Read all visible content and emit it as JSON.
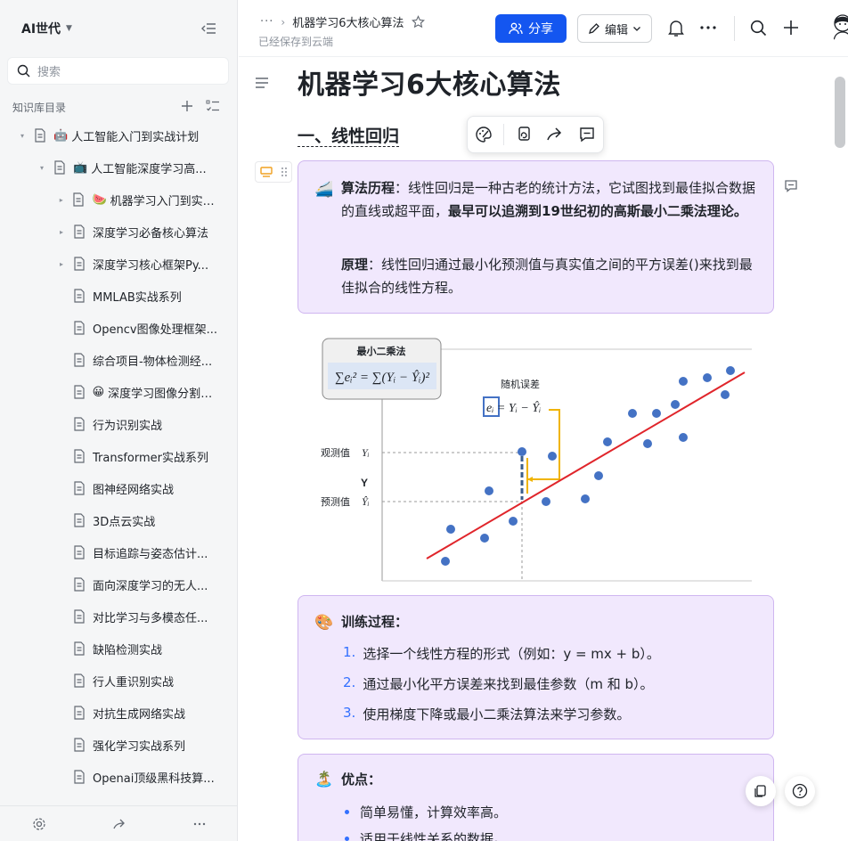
{
  "sidebar": {
    "workspace": "AI世代",
    "search_placeholder": "搜索",
    "section_title": "知识库目录",
    "items": [
      {
        "label": "人工智能入门到实战计划",
        "emoji": "🤖",
        "expander": "▾"
      },
      {
        "label": "人工智能深度学习高...",
        "emoji": "📺",
        "expander": "▾"
      },
      {
        "label": "机器学习入门到实战...",
        "emoji": "🍉",
        "expander": "▸"
      },
      {
        "label": "深度学习必备核心算法",
        "emoji": "",
        "expander": "▸"
      },
      {
        "label": "深度学习核心框架Py...",
        "emoji": "",
        "expander": "▸"
      },
      {
        "label": "MMLAB实战系列",
        "emoji": "",
        "expander": ""
      },
      {
        "label": "Opencv图像处理框架...",
        "emoji": "",
        "expander": ""
      },
      {
        "label": "综合项目-物体检测经...",
        "emoji": "",
        "expander": ""
      },
      {
        "label": "深度学习图像分割实战",
        "emoji": "😀",
        "expander": ""
      },
      {
        "label": "行为识别实战",
        "emoji": "",
        "expander": ""
      },
      {
        "label": "Transformer实战系列",
        "emoji": "",
        "expander": ""
      },
      {
        "label": "图神经网络实战",
        "emoji": "",
        "expander": ""
      },
      {
        "label": "3D点云实战",
        "emoji": "",
        "expander": ""
      },
      {
        "label": "目标追踪与姿态估计...",
        "emoji": "",
        "expander": ""
      },
      {
        "label": "面向深度学习的无人...",
        "emoji": "",
        "expander": ""
      },
      {
        "label": "对比学习与多模态任...",
        "emoji": "",
        "expander": ""
      },
      {
        "label": "缺陷检测实战",
        "emoji": "",
        "expander": ""
      },
      {
        "label": "行人重识别实战",
        "emoji": "",
        "expander": ""
      },
      {
        "label": "对抗生成网络实战",
        "emoji": "",
        "expander": ""
      },
      {
        "label": "强化学习实战系列",
        "emoji": "",
        "expander": ""
      },
      {
        "label": "Openai顶级黑科技算...",
        "emoji": "",
        "expander": ""
      }
    ]
  },
  "topbar": {
    "breadcrumb_more": "···",
    "breadcrumb_title": "机器学习6大核心算法",
    "saved_status": "已经保存到云端",
    "share_label": "分享",
    "edit_label": "编辑"
  },
  "doc": {
    "title": "机器学习6大核心算法",
    "section1": "一、线性回归",
    "callout1": {
      "emoji": "🚄",
      "history_label": "算法历程",
      "history_text": "：线性回归是一种古老的统计方法，它试图找到最佳拟合数据的直线或超平面，",
      "history_bold": "最早可以追溯到19世纪初的高斯最小二乘法理论。",
      "principle_label": "原理",
      "principle_text": "：线性回归通过最小化预测值与真实值之间的平方误差()来找到最佳拟合的线性方程。"
    },
    "figure": {
      "box_title": "最小二乘法",
      "box_formula": "∑eᵢ² = ∑(Yᵢ − Ŷᵢ)²",
      "error_label": "随机误差",
      "error_formula": "eᵢ = Yᵢ − Ŷᵢ",
      "observed_label": "观测值",
      "observed_sym": "Yᵢ",
      "predicted_label": "预测值",
      "predicted_sym": "Ŷᵢ",
      "y_axis_label": "Y"
    },
    "callout2": {
      "emoji": "🎨",
      "heading": "训练过程",
      "steps": [
        {
          "num": "1.",
          "text": "选择一个线性方程的形式（例如：y = mx + b）。"
        },
        {
          "num": "2.",
          "text": "通过最小化平方误差来找到最佳参数（m 和 b）。"
        },
        {
          "num": "3.",
          "text": "使用梯度下降或最小二乘法算法来学习参数。"
        }
      ]
    },
    "callout3": {
      "emoji": "🏝️",
      "heading": "优点",
      "bullets": [
        "简单易懂，计算效率高。",
        "适用于线性关系的数据。"
      ]
    }
  },
  "colors": {
    "accent": "#1456f0",
    "callout_bg": "#f1e8fd",
    "callout_border": "#cfb6f0",
    "point": "#4472c4",
    "fit_line": "#e0252b",
    "error_bracket": "#f0b400"
  }
}
